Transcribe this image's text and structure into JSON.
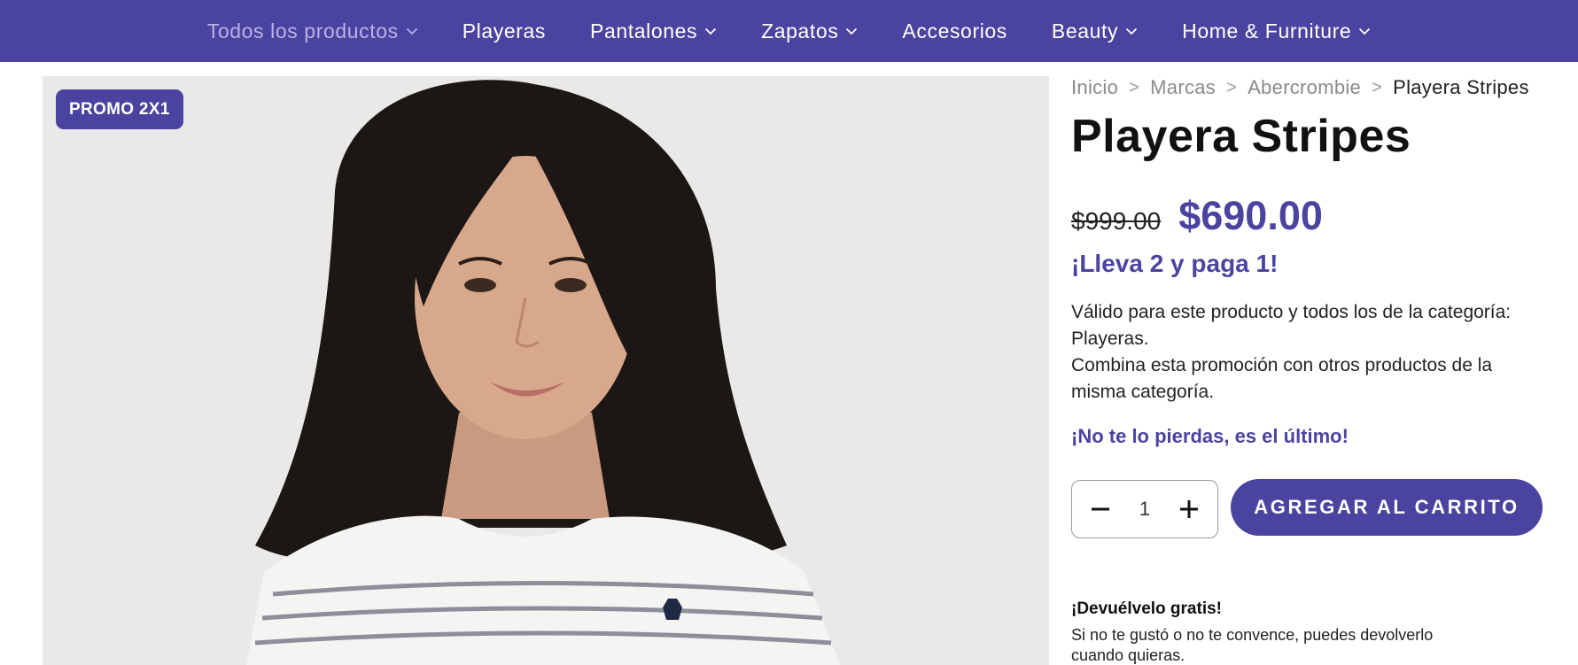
{
  "nav": {
    "items": [
      {
        "label": "Todos los productos",
        "has_dropdown": true,
        "active": true
      },
      {
        "label": "Playeras",
        "has_dropdown": false,
        "active": false
      },
      {
        "label": "Pantalones",
        "has_dropdown": true,
        "active": false
      },
      {
        "label": "Zapatos",
        "has_dropdown": true,
        "active": false
      },
      {
        "label": "Accesorios",
        "has_dropdown": false,
        "active": false
      },
      {
        "label": "Beauty",
        "has_dropdown": true,
        "active": false
      },
      {
        "label": "Home & Furniture",
        "has_dropdown": true,
        "active": false
      }
    ]
  },
  "product_image": {
    "badge": "PROMO 2X1"
  },
  "breadcrumb": {
    "items": [
      "Inicio",
      "Marcas",
      "Abercrombie",
      "Playera Stripes"
    ],
    "separator": ">"
  },
  "product": {
    "title": "Playera Stripes",
    "old_price": "$999.00",
    "price": "$690.00",
    "promo_headline": "¡Lleva 2 y paga 1!",
    "promo_desc_1": "Válido para este producto y todos los de la categoría: Playeras.",
    "promo_desc_2": "Combina esta promoción con otros productos de la misma categoría.",
    "last_one": "¡No te lo pierdas, es el último!"
  },
  "cart": {
    "quantity": "1",
    "add_label": "AGREGAR AL CARRITO"
  },
  "returns": {
    "title": "¡Devuélvelo gratis!",
    "text": "Si no te gustó o no te convence, puedes devolverlo cuando quieras."
  },
  "colors": {
    "brand": "#4a44a0",
    "nav_active": "#b7b3e6",
    "image_bg": "#e9e9e7"
  },
  "icons": [
    "chevron-down-icon",
    "minus-icon",
    "plus-icon"
  ]
}
